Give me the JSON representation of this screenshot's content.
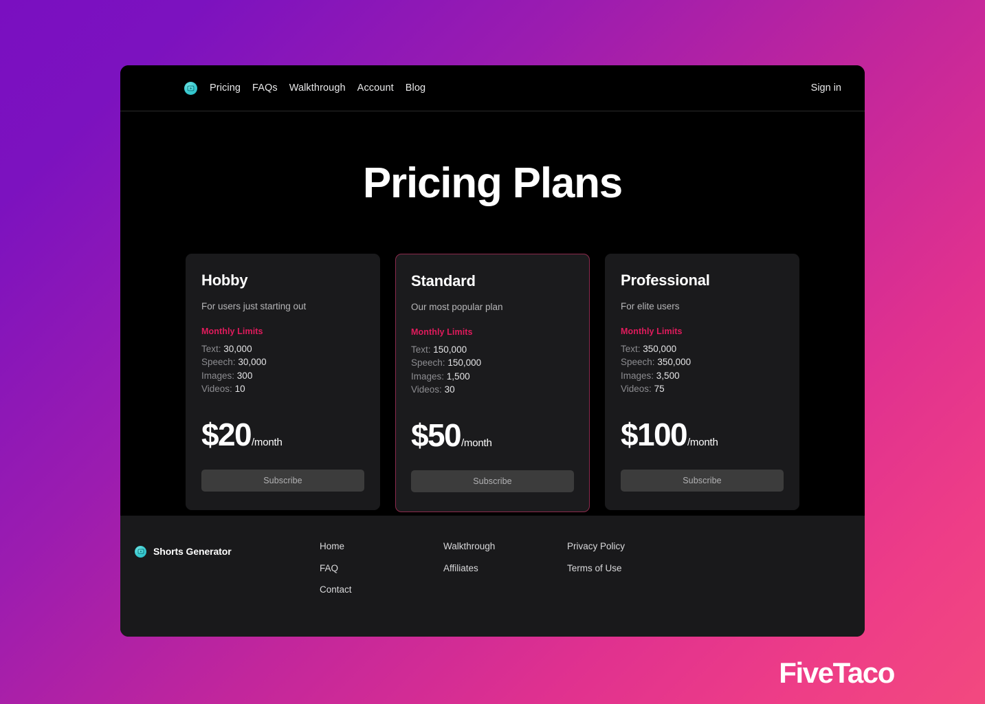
{
  "header": {
    "logo_icon": "video-play-circle-icon",
    "nav": [
      {
        "label": "Pricing"
      },
      {
        "label": "FAQs"
      },
      {
        "label": "Walkthrough"
      },
      {
        "label": "Account"
      },
      {
        "label": "Blog"
      }
    ],
    "signin_label": "Sign in"
  },
  "main": {
    "title": "Pricing Plans",
    "limits_heading": "Monthly Limits",
    "subscribe_label": "Subscribe",
    "plans": [
      {
        "name": "Hobby",
        "tagline": "For users just starting out",
        "limits": [
          {
            "label": "Text:",
            "value": "30,000"
          },
          {
            "label": "Speech:",
            "value": "30,000"
          },
          {
            "label": "Images:",
            "value": "300"
          },
          {
            "label": "Videos:",
            "value": "10"
          }
        ],
        "price": "$20",
        "period": "/month",
        "cta": "Subscribe",
        "featured": false
      },
      {
        "name": "Standard",
        "tagline": "Our most popular plan",
        "limits": [
          {
            "label": "Text:",
            "value": "150,000"
          },
          {
            "label": "Speech:",
            "value": "150,000"
          },
          {
            "label": "Images:",
            "value": "1,500"
          },
          {
            "label": "Videos:",
            "value": "30"
          }
        ],
        "price": "$50",
        "period": "/month",
        "cta": "Subscribe",
        "featured": true
      },
      {
        "name": "Professional",
        "tagline": "For elite users",
        "limits": [
          {
            "label": "Text:",
            "value": "350,000"
          },
          {
            "label": "Speech:",
            "value": "350,000"
          },
          {
            "label": "Images:",
            "value": "3,500"
          },
          {
            "label": "Videos:",
            "value": "75"
          }
        ],
        "price": "$100",
        "period": "/month",
        "cta": "Subscribe",
        "featured": false
      }
    ]
  },
  "footer": {
    "logo_icon": "video-play-circle-icon",
    "brand_name": "Shorts Generator",
    "columns": [
      {
        "links": [
          {
            "label": "Home"
          },
          {
            "label": "FAQ"
          },
          {
            "label": "Contact"
          }
        ]
      },
      {
        "links": [
          {
            "label": "Walkthrough"
          },
          {
            "label": "Affiliates"
          }
        ]
      },
      {
        "links": [
          {
            "label": "Privacy Policy"
          },
          {
            "label": "Terms of Use"
          }
        ]
      }
    ]
  },
  "watermark": {
    "text": "FiveTaco"
  },
  "colors": {
    "accent_pink": "#e01b5c",
    "brand_cyan": "#38c9cf",
    "featured_border": "#8d2a4d",
    "page_bg_start": "#7a0fc0",
    "page_bg_end": "#f2497f",
    "window_bg": "#000000",
    "card_bg": "#1a1a1c",
    "footer_bg": "#19191b",
    "button_bg": "#3c3c3c"
  }
}
